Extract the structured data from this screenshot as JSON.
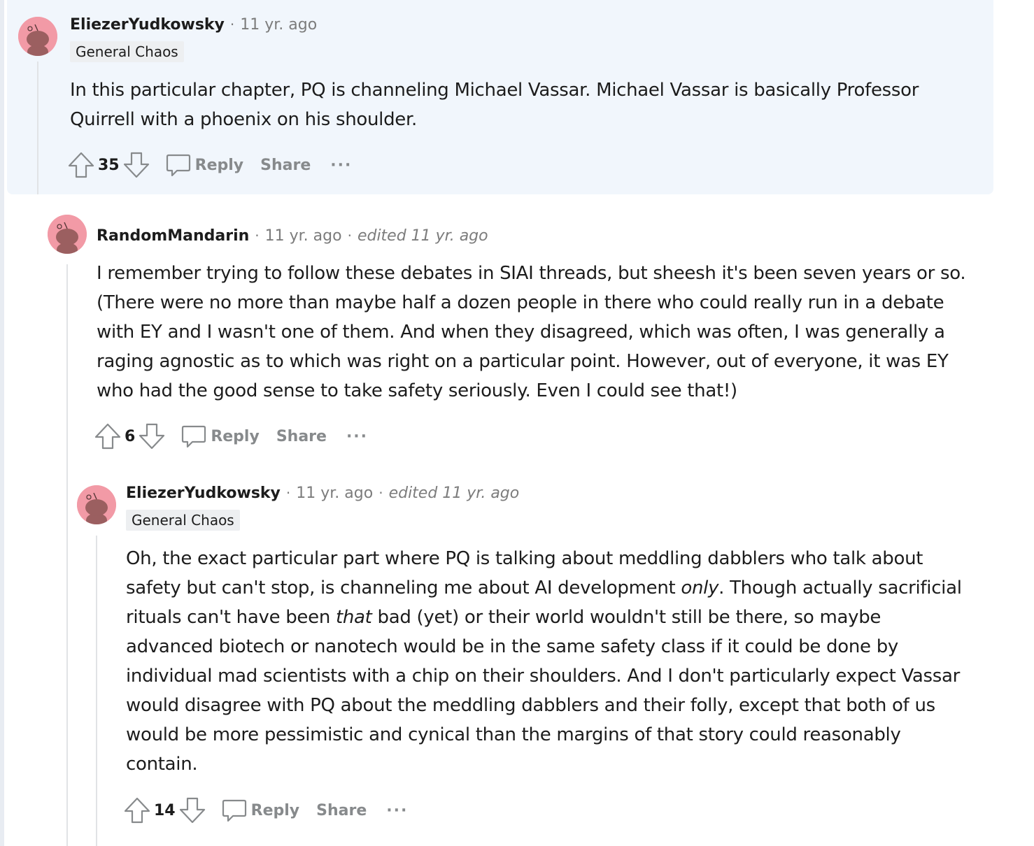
{
  "comments": [
    {
      "username": "EliezerYudkowsky",
      "time": "11 yr. ago",
      "edited": "",
      "flair": "General Chaos",
      "paragraphs": [
        "In this particular chapter, PQ is channeling Michael Vassar. Michael Vassar is basically Professor Quirrell with a phoenix on his shoulder."
      ],
      "score": "35",
      "reply_label": "Reply",
      "share_label": "Share",
      "more_label": "···"
    },
    {
      "username": "RandomMandarin",
      "time": "11 yr. ago",
      "edited": "edited 11 yr. ago",
      "flair": "",
      "paragraphs": [
        "I remember trying to follow these debates in SIAI threads, but sheesh it's been seven years or so. (There were no more than maybe half a dozen people in there who could really run in a debate with EY and I wasn't one of them. And when they disagreed, which was often, I was generally a raging agnostic as to which was right on a particular point. However, out of everyone, it was EY who had the good sense to take safety seriously. Even I could see that!)"
      ],
      "score": "6",
      "reply_label": "Reply",
      "share_label": "Share",
      "more_label": "···"
    },
    {
      "username": "EliezerYudkowsky",
      "time": "11 yr. ago",
      "edited": "edited 11 yr. ago",
      "flair": "General Chaos",
      "text_parts": {
        "a": "Oh, the exact particular part where PQ is talking about meddling dabblers who talk about safety but can't stop, is channeling me about AI development ",
        "b": "only",
        "c": ". Though actually sacrificial rituals can't have been ",
        "d": "that",
        "e": " bad (yet) or their world wouldn't still be there, so maybe advanced biotech or nanotech would be in the same safety class if it could be done by individual mad scientists with a chip on their shoulders. And I don't particularly expect Vassar would disagree with PQ about the meddling dabblers and their folly, except that both of us would be more pessimistic and cynical than the margins of that story could reasonably contain."
      },
      "score": "14",
      "reply_label": "Reply",
      "share_label": "Share",
      "more_label": "···"
    }
  ],
  "icons": {
    "upvote": "upvote-arrow-icon",
    "downvote": "downvote-arrow-icon",
    "reply": "speech-bubble-icon",
    "avatar": "snoo-avatar-icon"
  },
  "colors": {
    "highlight_bg": "#f1f6fc",
    "meta_gray": "#7c7c7c",
    "action_gray": "#878a8c",
    "avatar_pink": "#f29aa6",
    "flair_bg": "#edeff1"
  }
}
